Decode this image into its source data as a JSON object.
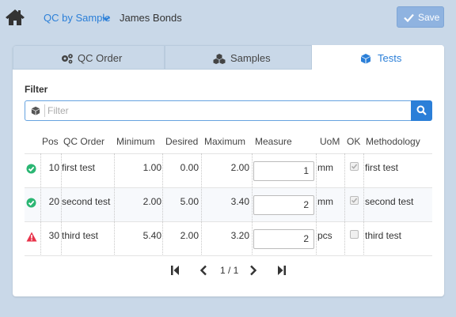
{
  "header": {
    "nav_title": "QC by Sample",
    "user_name": "James Bonds",
    "save_label": "Save",
    "icons": {
      "home": "home-icon",
      "nav_caret": "chevron-down-icon",
      "save": "check-icon"
    }
  },
  "tabs": [
    {
      "label": "QC Order",
      "icon": "gears-icon",
      "active": false
    },
    {
      "label": "Samples",
      "icon": "cubes-icon",
      "active": false
    },
    {
      "label": "Tests",
      "icon": "cube-icon",
      "active": true
    }
  ],
  "filter": {
    "label": "Filter",
    "placeholder": "Filter",
    "value": ""
  },
  "table": {
    "columns": [
      "Pos",
      "QC Order",
      "Minimum",
      "Desired",
      "Maximum",
      "Measure",
      "UoM",
      "OK",
      "Methodology"
    ],
    "rows": [
      {
        "status": "ok",
        "pos": "10",
        "qc_order": "first test",
        "minimum": "1.00",
        "desired": "0.00",
        "maximum": "2.00",
        "measure": "1",
        "uom": "mm",
        "ok": true,
        "methodology": "first test"
      },
      {
        "status": "ok",
        "pos": "20",
        "qc_order": "second test",
        "minimum": "2.00",
        "desired": "5.00",
        "maximum": "3.40",
        "measure": "2",
        "uom": "mm",
        "ok": true,
        "methodology": "second test"
      },
      {
        "status": "warning",
        "pos": "30",
        "qc_order": "third test",
        "minimum": "5.40",
        "desired": "2.00",
        "maximum": "3.20",
        "measure": "2",
        "uom": "pcs",
        "ok": false,
        "methodology": "third test"
      }
    ]
  },
  "pager": {
    "text": "1 / 1"
  },
  "colors": {
    "accent": "#2b7fd8",
    "background": "#c9d8e8",
    "save_button": "#8fb3e0",
    "ok_status": "#2bb673",
    "warning_status": "#e8334a"
  }
}
